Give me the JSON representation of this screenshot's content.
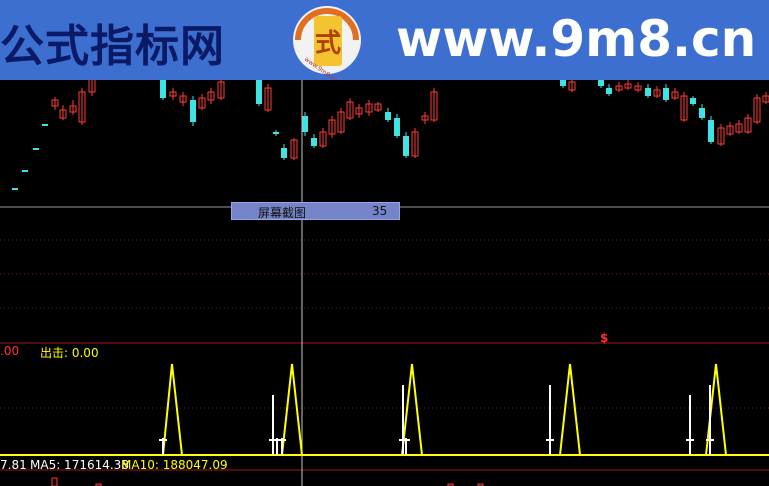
{
  "banner": {
    "left_text": "公式指标网",
    "right_text": "www.9m8.cn",
    "logo_char": "式",
    "logo_url_text": "www.9m8.cn",
    "bg_color": "#3d6fd1"
  },
  "tooltip": {
    "label": "屏幕截图",
    "value": "35"
  },
  "indicator": {
    "left_value": ".00",
    "exit_label": "出击: 0.00",
    "signal_symbol": "$",
    "line_color": "#ffff00"
  },
  "ma_bar": {
    "vol": "7.81",
    "ma5_label": "MA5: 171614.38",
    "ma10_label": "MA10: 188047.09"
  },
  "colors": {
    "up": "#ff3b3b",
    "down": "#3fe3e3",
    "signal": "#ffff00",
    "grid": "#7a1f1f"
  }
}
